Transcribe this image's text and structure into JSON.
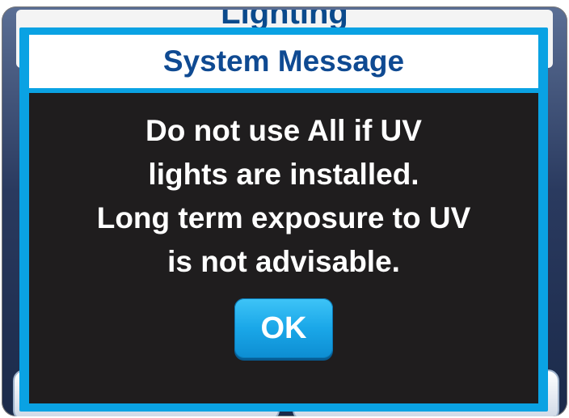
{
  "background": {
    "title": "Lighting"
  },
  "dialog": {
    "title": "System Message",
    "message_lines": [
      "Do not use All if UV",
      "lights are installed.",
      "Long term exposure to UV",
      "is not advisable."
    ],
    "ok_label": "OK"
  },
  "colors": {
    "dialog_frame": "#0aa2e3",
    "dialog_body": "#1f1d1e",
    "title_text": "#0f4a92",
    "message_text": "#ffffff",
    "button": "#1aa7e8"
  }
}
